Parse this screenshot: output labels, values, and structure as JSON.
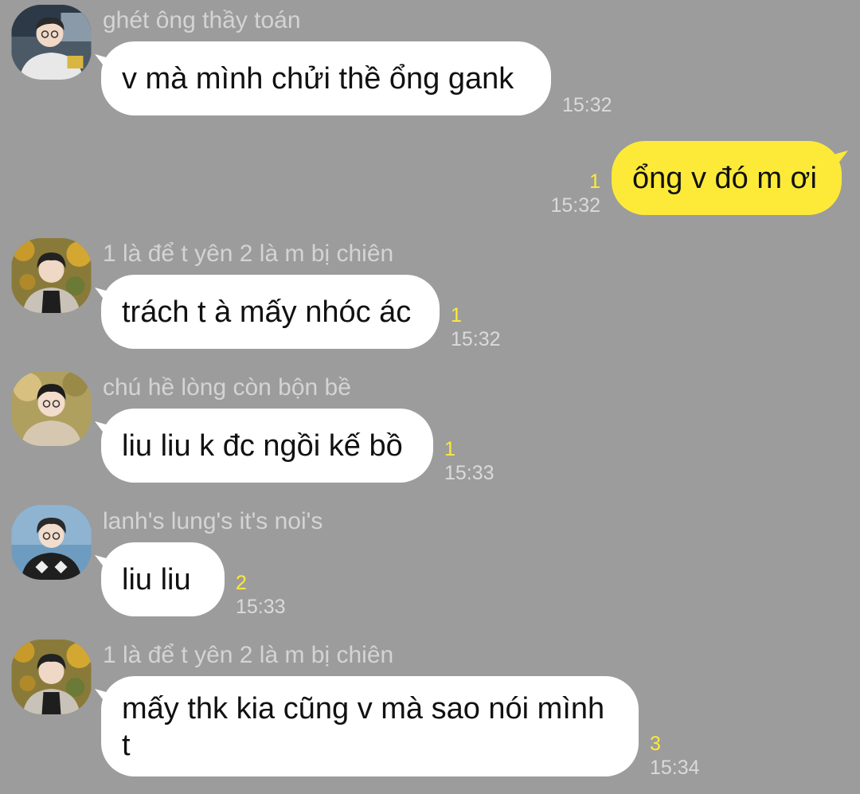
{
  "messages": [
    {
      "sender": "ghét ông thầy toán",
      "text": "v mà mình chửi thề ổng gank",
      "unread": "",
      "time": "15:32"
    },
    {
      "text": "ổng v đó m ơi",
      "unread": "1",
      "time": "15:32",
      "outgoing": true
    },
    {
      "sender": "1 là để t yên 2 là m bị chiên",
      "text": "trách t à mấy nhóc ác",
      "unread": "1",
      "time": "15:32"
    },
    {
      "sender": "chú hề lòng còn bộn bề",
      "text": "liu liu k đc ngồi kế bồ",
      "unread": "1",
      "time": "15:33"
    },
    {
      "sender": "lanh's lung's it's noi's",
      "text": "liu liu",
      "unread": "2",
      "time": "15:33"
    },
    {
      "sender": "1 là để t yên 2 là m bị chiên",
      "text_line1": "mấy thk kia cũng v mà sao nói mình",
      "text_line2": "t",
      "unread": "3",
      "time": "15:34"
    }
  ],
  "colors": {
    "background": "#9c9c9c",
    "incoming_bubble": "#ffffff",
    "outgoing_bubble": "#fdea38",
    "unread_count": "#fdea38",
    "sender_name": "#d4d4d4"
  }
}
